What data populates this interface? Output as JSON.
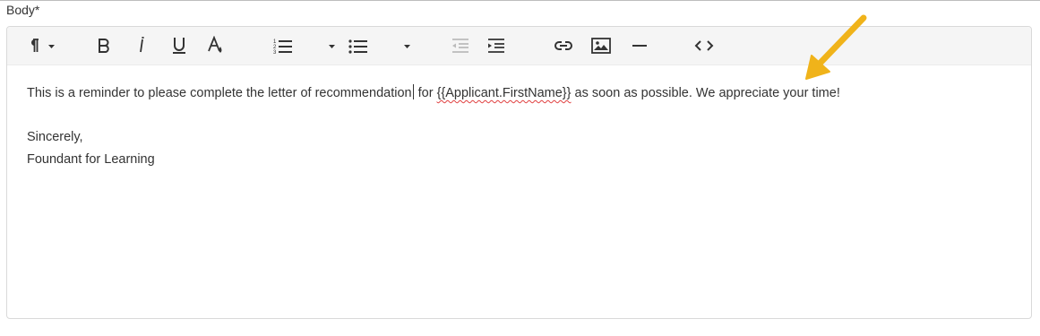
{
  "field": {
    "label": "Body*"
  },
  "toolbar": {
    "buttons": [
      {
        "name": "paragraph-format",
        "icon": "pilcrow-icon"
      },
      {
        "name": "bold",
        "icon": "bold-icon"
      },
      {
        "name": "italic",
        "icon": "italic-icon"
      },
      {
        "name": "underline",
        "icon": "underline-icon"
      },
      {
        "name": "text-color",
        "icon": "text-color-icon"
      },
      {
        "name": "ordered-list",
        "icon": "ordered-list-icon"
      },
      {
        "name": "unordered-list",
        "icon": "unordered-list-icon"
      },
      {
        "name": "outdent",
        "icon": "outdent-icon",
        "disabled": true
      },
      {
        "name": "indent",
        "icon": "indent-icon"
      },
      {
        "name": "insert-link",
        "icon": "link-icon"
      },
      {
        "name": "insert-image",
        "icon": "image-icon"
      },
      {
        "name": "horizontal-line",
        "icon": "horizontal-line-icon"
      },
      {
        "name": "code-view",
        "icon": "code-icon"
      }
    ]
  },
  "body": {
    "line1_before_caret": "This is a reminder to please complete the letter of recommendation",
    "line1_after_caret": " for ",
    "merge_field": "{{Applicant.FirstName}}",
    "line1_end": " as soon as possible. We appreciate your time!",
    "closing": "Sincerely,",
    "signature": "Foundant for Learning"
  },
  "colors": {
    "annotation_arrow": "#f0b31a",
    "toolbar_bg": "#f5f5f5",
    "icon": "#333333",
    "disabled_icon": "#bbbbbb"
  }
}
